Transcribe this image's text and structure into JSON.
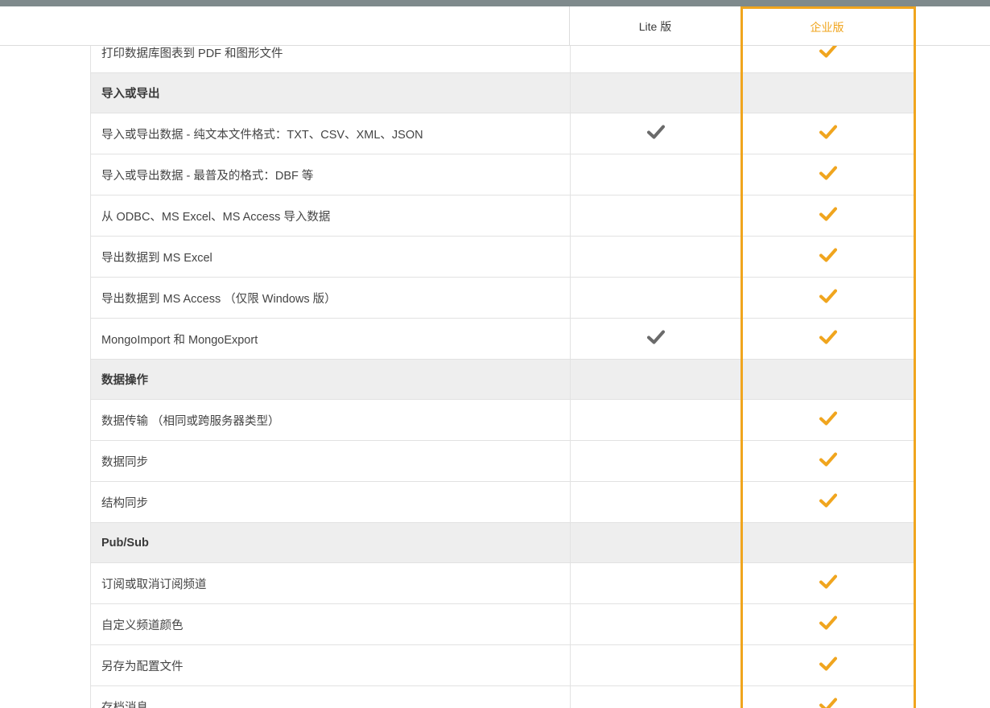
{
  "header": {
    "lite_label": "Lite 版",
    "enterprise_label": "企业版"
  },
  "colors": {
    "accent": "#f0a51e",
    "lite_check": "#6a6a6a",
    "section_bg": "#eeeeee",
    "topbar": "#7f8a8c"
  },
  "rows": [
    {
      "type": "feature",
      "label": "打印数据库图表到 PDF 和图形文件",
      "lite": false,
      "enterprise": true
    },
    {
      "type": "section",
      "label": "导入或导出"
    },
    {
      "type": "feature",
      "label": "导入或导出数据 - 纯文本文件格式：TXT、CSV、XML、JSON",
      "lite": true,
      "enterprise": true
    },
    {
      "type": "feature",
      "label": "导入或导出数据 - 最普及的格式：DBF 等",
      "lite": false,
      "enterprise": true
    },
    {
      "type": "feature",
      "label": "从 ODBC、MS Excel、MS Access 导入数据",
      "lite": false,
      "enterprise": true
    },
    {
      "type": "feature",
      "label": "导出数据到 MS Excel",
      "lite": false,
      "enterprise": true
    },
    {
      "type": "feature",
      "label": "导出数据到 MS Access （仅限 Windows 版）",
      "lite": false,
      "enterprise": true
    },
    {
      "type": "feature",
      "label": "MongoImport 和 MongoExport",
      "lite": true,
      "enterprise": true
    },
    {
      "type": "section",
      "label": "数据操作"
    },
    {
      "type": "feature",
      "label": "数据传输 （相同或跨服务器类型）",
      "lite": false,
      "enterprise": true
    },
    {
      "type": "feature",
      "label": "数据同步",
      "lite": false,
      "enterprise": true
    },
    {
      "type": "feature",
      "label": "结构同步",
      "lite": false,
      "enterprise": true
    },
    {
      "type": "section",
      "label": "Pub/Sub"
    },
    {
      "type": "feature",
      "label": "订阅或取消订阅频道",
      "lite": false,
      "enterprise": true
    },
    {
      "type": "feature",
      "label": "自定义频道颜色",
      "lite": false,
      "enterprise": true
    },
    {
      "type": "feature",
      "label": "另存为配置文件",
      "lite": false,
      "enterprise": true
    },
    {
      "type": "feature",
      "label": "存档消息",
      "lite": false,
      "enterprise": true
    }
  ]
}
